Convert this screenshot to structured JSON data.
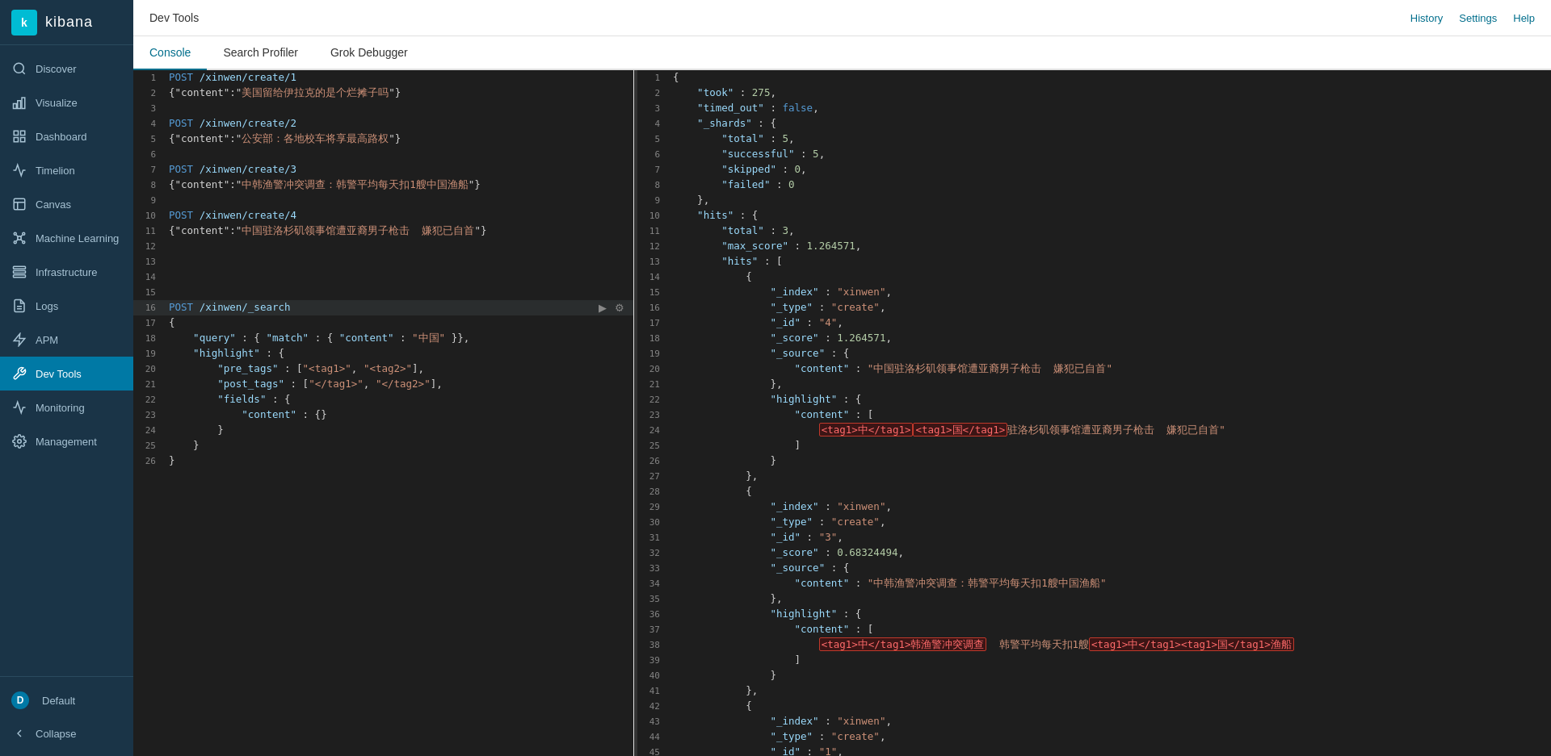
{
  "app": {
    "name": "kibana",
    "logo_letter": "k"
  },
  "header": {
    "title": "Dev Tools",
    "history": "History",
    "settings": "Settings",
    "help": "Help"
  },
  "tabs": [
    {
      "id": "console",
      "label": "Console",
      "active": true
    },
    {
      "id": "search-profiler",
      "label": "Search Profiler",
      "active": false
    },
    {
      "id": "grok-debugger",
      "label": "Grok Debugger",
      "active": false
    }
  ],
  "sidebar": {
    "items": [
      {
        "id": "discover",
        "label": "Discover",
        "icon": "🔍"
      },
      {
        "id": "visualize",
        "label": "Visualize",
        "icon": "📊"
      },
      {
        "id": "dashboard",
        "label": "Dashboard",
        "icon": "📋"
      },
      {
        "id": "timelion",
        "label": "Timelion",
        "icon": "📈"
      },
      {
        "id": "canvas",
        "label": "Canvas",
        "icon": "🖼"
      },
      {
        "id": "machine-learning",
        "label": "Machine Learning",
        "icon": "🧠"
      },
      {
        "id": "infrastructure",
        "label": "Infrastructure",
        "icon": "🏗"
      },
      {
        "id": "logs",
        "label": "Logs",
        "icon": "📄"
      },
      {
        "id": "apm",
        "label": "APM",
        "icon": "⚡"
      },
      {
        "id": "dev-tools",
        "label": "Dev Tools",
        "icon": "⚙",
        "active": true
      },
      {
        "id": "monitoring",
        "label": "Monitoring",
        "icon": "📡"
      },
      {
        "id": "management",
        "label": "Management",
        "icon": "🔧"
      }
    ],
    "bottom": [
      {
        "id": "default",
        "label": "Default",
        "icon": "D"
      },
      {
        "id": "collapse",
        "label": "Collapse",
        "icon": "◀"
      }
    ]
  }
}
